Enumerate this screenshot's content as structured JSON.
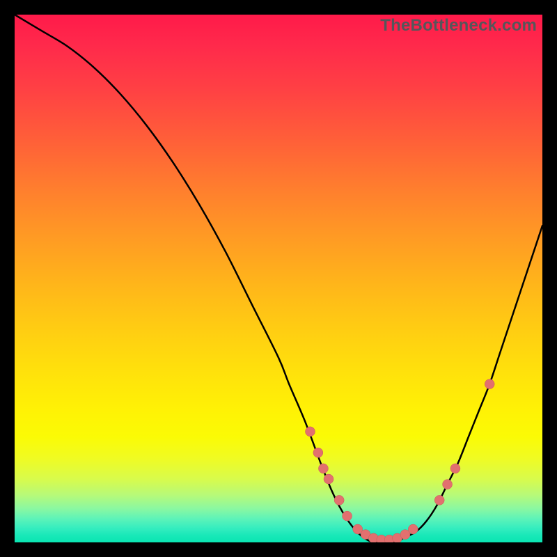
{
  "watermark": "TheBottleneck.com",
  "colors": {
    "background": "#000000",
    "curve": "#000000",
    "dot_fill": "#e2706f",
    "dot_stroke": "#c95a58",
    "gradient_top": "#ff1a4a",
    "gradient_bottom": "#0ae5b2"
  },
  "chart_data": {
    "type": "line",
    "title": "",
    "xlabel": "",
    "ylabel": "",
    "xlim": [
      0,
      100
    ],
    "ylim": [
      0,
      100
    ],
    "series": [
      {
        "name": "bottleneck-curve",
        "x": [
          0,
          5,
          10,
          15,
          20,
          25,
          30,
          35,
          40,
          45,
          50,
          52,
          55,
          58,
          60,
          62,
          64,
          66,
          68,
          70,
          72,
          74,
          76,
          78,
          80,
          82,
          84,
          86,
          88,
          90,
          92,
          94,
          96,
          98,
          100
        ],
        "y": [
          100,
          97,
          94,
          90,
          85,
          79,
          72,
          64,
          55,
          45,
          35,
          30,
          23,
          15,
          10,
          6,
          3,
          1,
          0,
          0,
          0,
          1,
          2,
          4,
          7,
          11,
          15,
          20,
          25,
          30,
          36,
          42,
          48,
          54,
          60
        ]
      }
    ],
    "markers": {
      "name": "highlight-points",
      "x": [
        56,
        57.5,
        58.5,
        59.5,
        61.5,
        63,
        65,
        66.5,
        68,
        69.5,
        71,
        72.5,
        74,
        75.5,
        80.5,
        82,
        83.5,
        90
      ],
      "y": [
        21,
        17,
        14,
        12,
        8,
        5,
        2.5,
        1.5,
        0.8,
        0.5,
        0.5,
        0.8,
        1.5,
        2.5,
        8,
        11,
        14,
        30
      ]
    }
  }
}
